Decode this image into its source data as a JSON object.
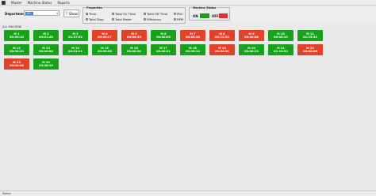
{
  "menu": {
    "items": [
      "Master",
      "Machine Status",
      "Reports"
    ]
  },
  "department": {
    "label": "Department",
    "value": "ALL"
  },
  "show_button": {
    "label": "Show"
  },
  "properties": {
    "title": "Properties",
    "options": [
      {
        "label": "Time",
        "selected": true
      },
      {
        "label": "Total On Time",
        "selected": false
      },
      {
        "label": "Total Off Time",
        "selected": false
      },
      {
        "label": "Pick",
        "selected": false
      },
      {
        "label": "Total Stop",
        "selected": false
      },
      {
        "label": "Total Meter",
        "selected": false
      },
      {
        "label": "Efficiency",
        "selected": false
      },
      {
        "label": "RPM",
        "selected": false
      }
    ]
  },
  "machine_status": {
    "title": "Machine Status",
    "on_label": "ON",
    "off_label": "OFF",
    "on_color": "#18a21c",
    "off_color": "#e2412a"
  },
  "section_title": "ALL MACHINE",
  "machines": [
    {
      "name": "M 1",
      "time": "00:00:10",
      "status": "on"
    },
    {
      "name": "M 2",
      "time": "00:01:28",
      "status": "on"
    },
    {
      "name": "M 3",
      "time": "01:37:52",
      "status": "on"
    },
    {
      "name": "M 4",
      "time": "00:00:37",
      "status": "off"
    },
    {
      "name": "M 5",
      "time": "00:06:35",
      "status": "off"
    },
    {
      "name": "M 6",
      "time": "00:00:05",
      "status": "on"
    },
    {
      "name": "M 7",
      "time": "00:05:36",
      "status": "off"
    },
    {
      "name": "M 8",
      "time": "00:12:52",
      "status": "off"
    },
    {
      "name": "M 9",
      "time": "00:00:06",
      "status": "off"
    },
    {
      "name": "M 10",
      "time": "00:00:15",
      "status": "on"
    },
    {
      "name": "M 11",
      "time": "01:15:33",
      "status": "on"
    },
    {
      "name": "M 12",
      "time": "00:30:20",
      "status": "on"
    },
    {
      "name": "M 13",
      "time": "00:00:08",
      "status": "on"
    },
    {
      "name": "M 14",
      "time": "00:01:11",
      "status": "on"
    },
    {
      "name": "M 15",
      "time": "00:00:06",
      "status": "on"
    },
    {
      "name": "M 16",
      "time": "00:00:30",
      "status": "on"
    },
    {
      "name": "M 17",
      "time": "00:00:31",
      "status": "on"
    },
    {
      "name": "M 18",
      "time": "00:00:12",
      "status": "on"
    },
    {
      "name": "M 19",
      "time": "00:00:32",
      "status": "off"
    },
    {
      "name": "M 20",
      "time": "00:00:13",
      "status": "on"
    },
    {
      "name": "M 21",
      "time": "01:15:32",
      "status": "on"
    },
    {
      "name": "M 22",
      "time": "00:00:06",
      "status": "off"
    },
    {
      "name": "M 23",
      "time": "00:00:08",
      "status": "off"
    },
    {
      "name": "M 24",
      "time": "23:48:16",
      "status": "on"
    }
  ],
  "footer": {
    "status_label": "Status"
  }
}
